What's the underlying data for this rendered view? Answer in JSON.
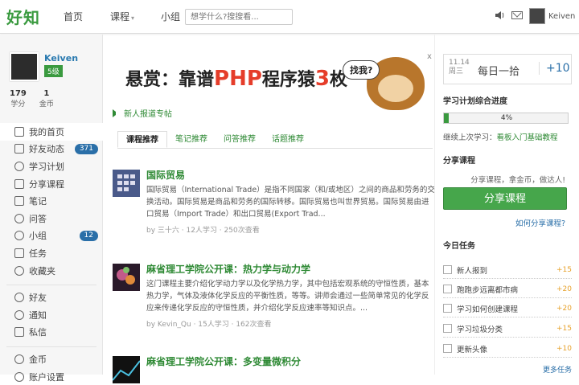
{
  "header": {
    "logo": "好知",
    "nav": [
      "首页",
      "课程",
      "小组"
    ],
    "nav_caret": "▾",
    "search_placeholder": "想学什么?搜搜看...",
    "username": "Keiven"
  },
  "profile": {
    "name": "Keiven",
    "level": "5级",
    "stats": [
      {
        "value": "179",
        "label": "学分"
      },
      {
        "value": "1",
        "label": "金币"
      }
    ]
  },
  "menu": [
    {
      "label": "我的首页",
      "icon": "home-icon"
    },
    {
      "label": "好友动态",
      "icon": "feed-icon",
      "badge": "371"
    },
    {
      "label": "学习计划",
      "icon": "plan-icon"
    },
    {
      "label": "分享课程",
      "icon": "share-icon"
    },
    {
      "label": "笔记",
      "icon": "note-icon"
    },
    {
      "label": "问答",
      "icon": "question-icon"
    },
    {
      "label": "小组",
      "icon": "group-icon",
      "badge": "12"
    },
    {
      "label": "任务",
      "icon": "task-icon"
    },
    {
      "label": "收藏夹",
      "icon": "star-icon"
    },
    {
      "label": "好友",
      "icon": "friend-icon"
    },
    {
      "label": "通知",
      "icon": "bell-icon"
    },
    {
      "label": "私信",
      "icon": "mail-icon"
    },
    {
      "label": "金币",
      "icon": "coin-icon"
    },
    {
      "label": "账户设置",
      "icon": "gear-icon"
    }
  ],
  "banner": {
    "part1": "悬赏：靠谱",
    "php": "PHP",
    "part2": "程序猿",
    "num": "3",
    "part3": "枚",
    "bubble": "找我?",
    "close": "x"
  },
  "notice": "新人报道专帖",
  "tabs": [
    "课程推荐",
    "笔记推荐",
    "问答推荐",
    "话题推荐"
  ],
  "courses": [
    {
      "title": "国际贸易",
      "desc": "国际贸易（International Trade）是指不同国家（和/或地区）之间的商品和劳务的交换活动。国际贸易是商品和劳务的国际转移。国际贸易也叫世界贸易。国际贸易由进口贸易（Import Trade）和出口贸易(Export Trad...",
      "meta": "by 三十六 · 12人学习 · 250次查看"
    },
    {
      "title": "麻省理工学院公开课：热力学与动力学",
      "desc": "这门课程主要介绍化学动力学以及化学热力学，其中包括宏观系统的守恒性质，基本热力学，气体及液体化学反应的平衡性质，等等。讲师会通过一些简单常见的化学反应来传递化学反应的守恒性质，并介绍化学反应速率等知识点。...",
      "meta": "by Kevin_Qu · 15人学习 · 162次查看"
    },
    {
      "title": "麻省理工学院公开课：多变量微积分",
      "desc": "",
      "meta": ""
    }
  ],
  "daily": {
    "date": "11.14",
    "weekday": "周三",
    "label": "每日一拾",
    "points": "+10"
  },
  "progress": {
    "title": "学习计划综合进度",
    "value": 0.04,
    "text": "4%"
  },
  "continue": {
    "label": "继续上次学习：",
    "link": "看板入门基础教程"
  },
  "share": {
    "title": "分享课程",
    "tip": "分享课程，拿金币，做达人!",
    "button": "分享课程",
    "how": "如何分享课程?"
  },
  "tasks": {
    "title": "今日任务",
    "items": [
      {
        "name": "新人报到",
        "points": "+15"
      },
      {
        "name": "跑跑步远离都市病",
        "points": "+20"
      },
      {
        "name": "学习如何创建课程",
        "points": "+20"
      },
      {
        "name": "学习垃圾分类",
        "points": "+15"
      },
      {
        "name": "更新头像",
        "points": "+10"
      }
    ],
    "more": "更多任务"
  },
  "colors": {
    "green": "#3a9a3f",
    "blue": "#2a6fa8",
    "orange": "#e7a12a"
  }
}
